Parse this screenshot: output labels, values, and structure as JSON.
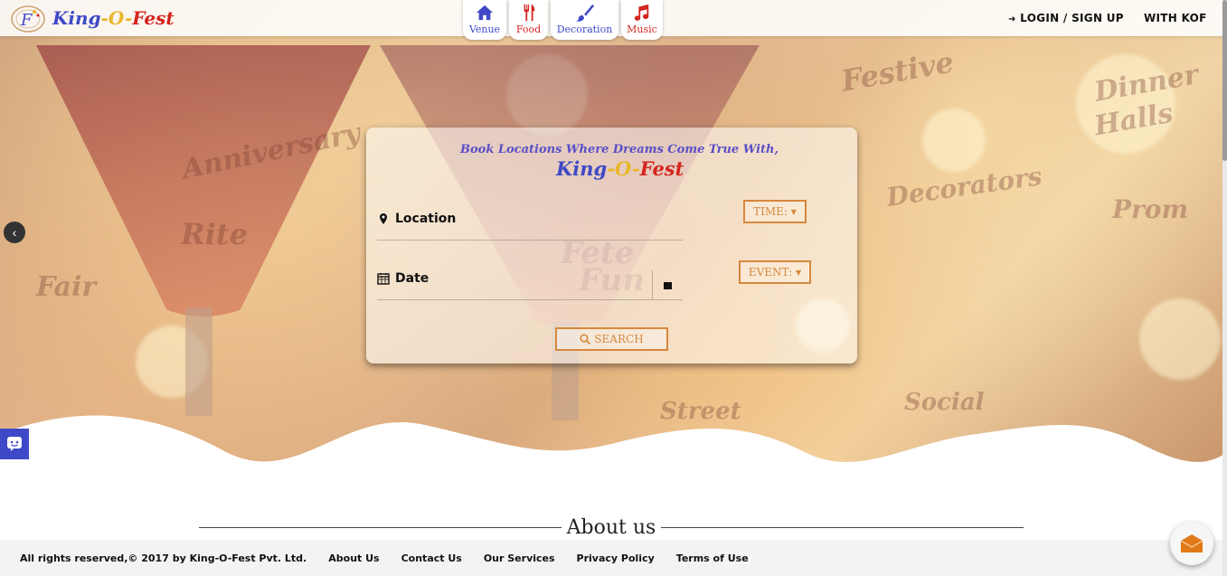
{
  "brand": {
    "name_part1": "King",
    "name_dash1": "-",
    "name_part2": "O",
    "name_dash2": "-",
    "name_part3": "Fest"
  },
  "nav": {
    "tabs": [
      {
        "label": "Venue",
        "icon": "home-icon",
        "color": "#3f49c7"
      },
      {
        "label": "Food",
        "icon": "utensils-icon",
        "color": "#d4241e"
      },
      {
        "label": "Decoration",
        "icon": "paintbrush-icon",
        "color": "#3f49c7"
      },
      {
        "label": "Music",
        "icon": "music-note-icon",
        "color": "#d4241e"
      }
    ],
    "login_label": "LOGIN / SIGN UP",
    "with_label": "WITH KOF"
  },
  "search_card": {
    "title": "Book Locations Where Dreams Come True With,",
    "location_label": "Location",
    "date_label": "Date",
    "time_label": "TIME:",
    "event_label": "EVENT:",
    "search_label": "SEARCH"
  },
  "about": {
    "heading": "About us"
  },
  "footer": {
    "copyright": "All rights reserved,© 2017 by King-O-Fest Pvt. Ltd.",
    "links": [
      "About Us",
      "Contact Us",
      "Our Services",
      "Privacy Policy",
      "Terms of Use"
    ]
  },
  "colors": {
    "accent": "#d7883d",
    "brand_blue": "#3f49c7",
    "brand_red": "#d4241e",
    "brand_yellow": "#e8b62a"
  }
}
